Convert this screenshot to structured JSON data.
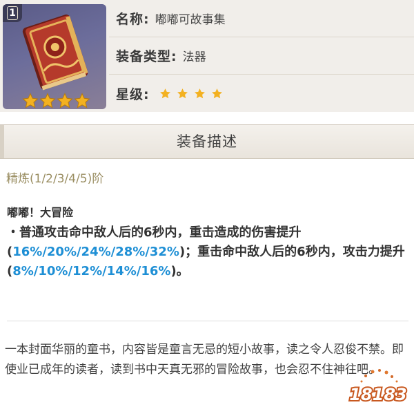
{
  "item": {
    "refine_level": "1",
    "name_label": "名称:",
    "name_value": "嘟嘟可故事集",
    "type_label": "装备类型:",
    "type_value": "法器",
    "rarity_label": "星级:",
    "rarity_stars": 4,
    "star_icon": "star-icon",
    "colors": {
      "star": "#f3b121",
      "thumb_bg": "#5f6090",
      "book": "#b53a2b"
    }
  },
  "section": {
    "title": "装备描述"
  },
  "refinement": {
    "label": "精炼(1/2/3/4/5)阶"
  },
  "effect": {
    "title": "嘟嘟！大冒险",
    "bullet": "・",
    "text_1": "普通攻击命中敌人后的6秒内，重击造成的伤害提升(",
    "values_1": "16%/20%/24%/28%/32%",
    "text_2": ")；重击命中敌人后的6秒内，攻击力提升(",
    "values_2": "8%/10%/12%/14%/16%",
    "text_3": ")。",
    "highlight_color": "#1e8fd5"
  },
  "description": {
    "text": "一本封面华丽的童书，内容皆是童言无忌的短小故事，读之令人忍俊不禁。即使业已成年的读者，读到书中天真无邪的冒险故事，也会忍不住神往吧。"
  },
  "watermark": {
    "text": "18183"
  }
}
